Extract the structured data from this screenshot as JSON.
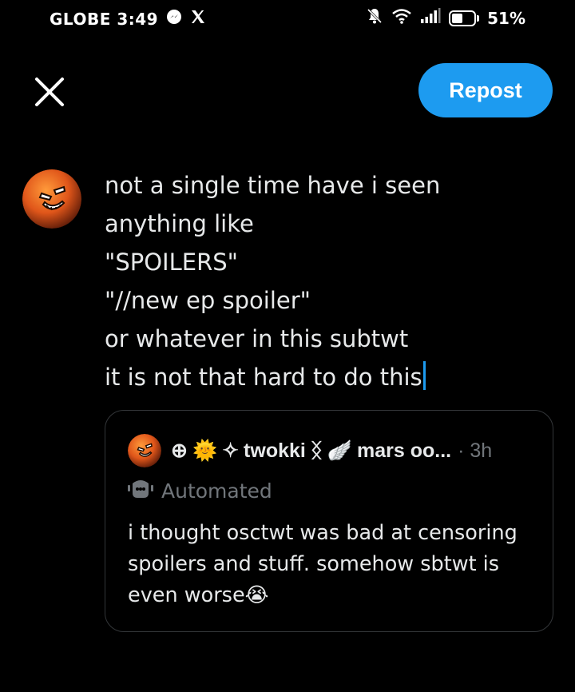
{
  "status_bar": {
    "carrier_time": "GLOBE 3:49",
    "battery_percent": "51%",
    "battery_level": 0.51,
    "icons": [
      "messenger-icon",
      "x-icon",
      "mute-bell-icon",
      "wifi-icon",
      "signal-icon",
      "battery-icon"
    ]
  },
  "toolbar": {
    "close_icon": "close-icon",
    "repost_label": "Repost",
    "accent_color": "#1d9bf0"
  },
  "compose": {
    "lines": [
      "not a single time have i seen",
      "anything like",
      "\"SPOILERS\"",
      "\"//new ep spoiler\"",
      "or whatever in this subtwt",
      "it is not that hard to do this"
    ]
  },
  "quote": {
    "display_name_prefix": "⊕",
    "display_name_emoji_sun": "🌞",
    "display_name_sparkle": "✧",
    "display_name": "twokki",
    "display_name_suffix": "ᛝ",
    "display_name_emoji_wing": "🪽",
    "handle": "mars oo...",
    "separator": "·",
    "timestamp": "3h",
    "automated_label": "Automated",
    "text": "i thought osctwt was bad at censoring spoilers and stuff. somehow sbtwt is even worse",
    "text_emoji": "😭"
  }
}
